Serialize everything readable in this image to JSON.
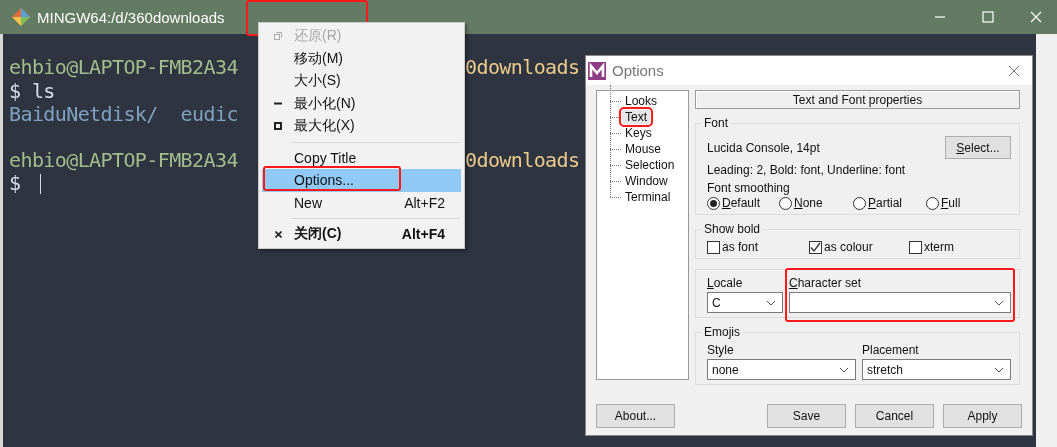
{
  "terminal": {
    "title": "MINGW64:/d/360downloads",
    "title_highlighted": true,
    "lines": [
      {
        "left": [
          {
            "text": "ehbio@LAPTOP-FMB2A34",
            "color": "#a3be8c"
          }
        ],
        "right": [
          {
            "text": "0downloads",
            "color": "#ebcb8b"
          }
        ],
        "gap_before": false,
        "cursor": false
      },
      {
        "left": [
          {
            "text": "$ ls",
            "color": "#d8dee9"
          }
        ],
        "gap_before": false,
        "cursor": false
      },
      {
        "left": [
          {
            "text": "BaiduNetdisk/  eudic",
            "color": "#81a1c1"
          }
        ],
        "gap_before": false,
        "cursor": false
      },
      {
        "left": [
          {
            "text": "ehbio@LAPTOP-FMB2A34",
            "color": "#a3be8c"
          }
        ],
        "right": [
          {
            "text": "0downloads",
            "color": "#ebcb8b"
          }
        ],
        "gap_before": true,
        "cursor": false
      },
      {
        "left": [
          {
            "text": "$ ",
            "color": "#d8dee9"
          }
        ],
        "gap_before": false,
        "cursor": true
      }
    ]
  },
  "menu": [
    {
      "kind": "restore",
      "label": "还原(R)",
      "disabled": true,
      "selected": false,
      "bold": false,
      "highlighted": false
    },
    {
      "kind": "item",
      "label": "移动(M)",
      "disabled": false,
      "selected": false,
      "bold": false,
      "highlighted": false
    },
    {
      "kind": "item",
      "label": "大小(S)",
      "disabled": false,
      "selected": false,
      "bold": false,
      "highlighted": false
    },
    {
      "kind": "minimize",
      "label": "最小化(N)",
      "disabled": false,
      "selected": false,
      "bold": false,
      "highlighted": false
    },
    {
      "kind": "maximize",
      "label": "最大化(X)",
      "disabled": false,
      "selected": false,
      "bold": false,
      "highlighted": false
    },
    {
      "kind": "separator"
    },
    {
      "kind": "item",
      "label": "Copy Title",
      "disabled": false,
      "selected": false,
      "bold": false,
      "highlighted": false
    },
    {
      "kind": "item",
      "label": "Options...",
      "disabled": false,
      "selected": true,
      "bold": false,
      "highlighted": true
    },
    {
      "kind": "item",
      "label": "New",
      "shortcut": "Alt+F2",
      "disabled": false,
      "selected": false,
      "bold": false,
      "highlighted": false
    },
    {
      "kind": "separator"
    },
    {
      "kind": "close",
      "label": "关闭(C)",
      "shortcut": "Alt+F4",
      "disabled": false,
      "selected": false,
      "bold": true,
      "highlighted": false
    }
  ],
  "dialog": {
    "title": "Options",
    "tree": [
      {
        "label": "Looks",
        "selected": false,
        "highlighted": false
      },
      {
        "label": "Text",
        "selected": true,
        "highlighted": true
      },
      {
        "label": "Keys",
        "selected": false,
        "highlighted": false
      },
      {
        "label": "Mouse",
        "selected": false,
        "highlighted": false
      },
      {
        "label": "Selection",
        "selected": false,
        "highlighted": false
      },
      {
        "label": "Window",
        "selected": false,
        "highlighted": false
      },
      {
        "label": "Terminal",
        "selected": false,
        "highlighted": false
      }
    ],
    "header": "Text and Font properties",
    "font": {
      "legend": "Font",
      "name": "Lucida Console, 14pt",
      "select_button": "Select...",
      "details": "Leading: 2, Bold: font, Underline: font",
      "smoothing_label": "Font smoothing",
      "smoothing_options": [
        {
          "label": "Default",
          "selected": true
        },
        {
          "label": "None",
          "selected": false
        },
        {
          "label": "Partial",
          "selected": false
        },
        {
          "label": "Full",
          "selected": false
        }
      ]
    },
    "show_bold": {
      "legend": "Show bold",
      "options": [
        {
          "label": "as font",
          "checked": false
        },
        {
          "label": "as colour",
          "checked": true
        },
        {
          "label": "xterm",
          "checked": false
        }
      ]
    },
    "locale": {
      "label": "Locale",
      "value": "C"
    },
    "charset": {
      "label": "Character set",
      "highlighted": true
    },
    "emojis": {
      "legend": "Emojis",
      "style": {
        "label": "Style",
        "value": "none"
      },
      "placement": {
        "label": "Placement",
        "value": "stretch"
      }
    },
    "about_button": "About...",
    "buttons": [
      "Save",
      "Cancel",
      "Apply"
    ]
  }
}
